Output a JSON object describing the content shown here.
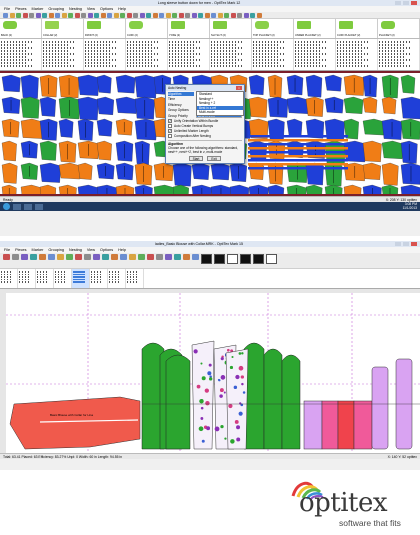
{
  "shot1": {
    "title": "Long sleeve button down for men - OptiTex Mark 12",
    "menu": [
      "File",
      "Pieces",
      "Marker",
      "Grouping",
      "Nesting",
      "View",
      "Options",
      "Help"
    ],
    "pieces": [
      "BACK (2)",
      "COLLAR (2)",
      "FRONT (2)",
      "CUFF (2)",
      "YOKE (2)",
      "SLV SLIT (2)",
      "TOP PLACKET (2)",
      "UNDER PLACKET (2)",
      "CUFF PLACKET (2)",
      "PLACKET (2)"
    ],
    "status_left": "Ready",
    "status_right": "X: 208  Y: 130  optitex",
    "clock_time": "3:08 PM",
    "clock_date": "11/1/2013"
  },
  "dialog": {
    "title": "Auto Nesting",
    "rows": [
      {
        "k": "Algorithm",
        "v": "Best in z-ref"
      },
      {
        "k": "Time",
        "v": "Standard"
      },
      {
        "k": "Efficiency",
        "v": "Nesting++"
      },
      {
        "k": "Group Options",
        "v": "Nesting + 2"
      },
      {
        "k": "Group Priority",
        "v": "Best in z-ref"
      }
    ],
    "list": [
      "Standard",
      "Nesting++",
      "Nesting + 2",
      "Best in z-ref",
      "Multi-mode"
    ],
    "checks": [
      {
        "label": "Unify Orientation Within Bundle",
        "checked": true
      },
      {
        "label": "Auto Create Vertical Bumps",
        "checked": false
      },
      {
        "label": "Unlimited Marker Length",
        "checked": true
      },
      {
        "label": "Composition After Nesting",
        "checked": false
      }
    ],
    "alg_heading": "Algorithm",
    "alg_text": "Choose one of the following algorithms: standard, nest++, nest++2, best in z, multi-mode",
    "start": "Start",
    "cancel": "Exit"
  },
  "shot2": {
    "title": "ladies_Basic Blouse with Collar.MRK - OptiTex Mark 15",
    "menu": [
      "File",
      "Pieces",
      "Marker",
      "Grouping",
      "Nesting",
      "View",
      "Options",
      "Help"
    ],
    "status_left": "Total: 63.41  Placed: 63  Efficiency: 83.27%  Unpl: 0  Width: 60 in  Length: 94.55 in",
    "status_right": "X: 140  Y: 52  optitex",
    "piece_label": "Basic Blouse with Collar for Lina"
  },
  "logo": {
    "word": "optitex",
    "tagline": "software that fits",
    "colors": [
      "#e23a3a",
      "#f1c232",
      "#5bb84d",
      "#3a8fd6",
      "#8c4fc1"
    ]
  }
}
